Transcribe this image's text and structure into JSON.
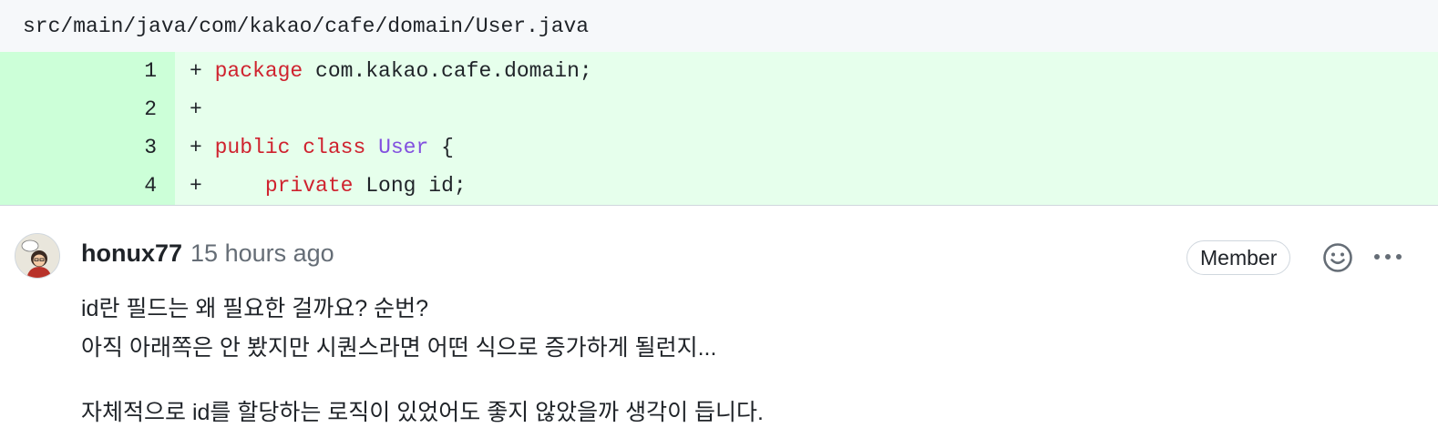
{
  "file": {
    "path": "src/main/java/com/kakao/cafe/domain/User.java"
  },
  "diff": {
    "lines": [
      {
        "num": "1",
        "prefix": "+ ",
        "tokens": [
          {
            "t": "package",
            "c": "kw"
          },
          {
            "t": " com.kakao.cafe.domain;",
            "c": ""
          }
        ]
      },
      {
        "num": "2",
        "prefix": "+",
        "tokens": []
      },
      {
        "num": "3",
        "prefix": "+ ",
        "tokens": [
          {
            "t": "public",
            "c": "kw"
          },
          {
            "t": " ",
            "c": ""
          },
          {
            "t": "class",
            "c": "kw"
          },
          {
            "t": " ",
            "c": ""
          },
          {
            "t": "User",
            "c": "cls"
          },
          {
            "t": " {",
            "c": ""
          }
        ]
      },
      {
        "num": "4",
        "prefix": "+     ",
        "tokens": [
          {
            "t": "private",
            "c": "kw"
          },
          {
            "t": " Long id;",
            "c": ""
          }
        ]
      }
    ]
  },
  "comment": {
    "author": "honux77",
    "time": "15 hours ago",
    "badge": "Member",
    "body": {
      "line1": "id란 필드는 왜 필요한 걸까요? 순번?",
      "line2": "아직 아래쪽은 안 봤지만 시퀀스라면 어떤 식으로 증가하게 될런지...",
      "line3": "자체적으로 id를 할당하는 로직이 있었어도 좋지 않았을까 생각이 듭니다."
    },
    "icons": {
      "emoji": "smiley-icon",
      "more": "kebab-horizontal-icon"
    }
  }
}
